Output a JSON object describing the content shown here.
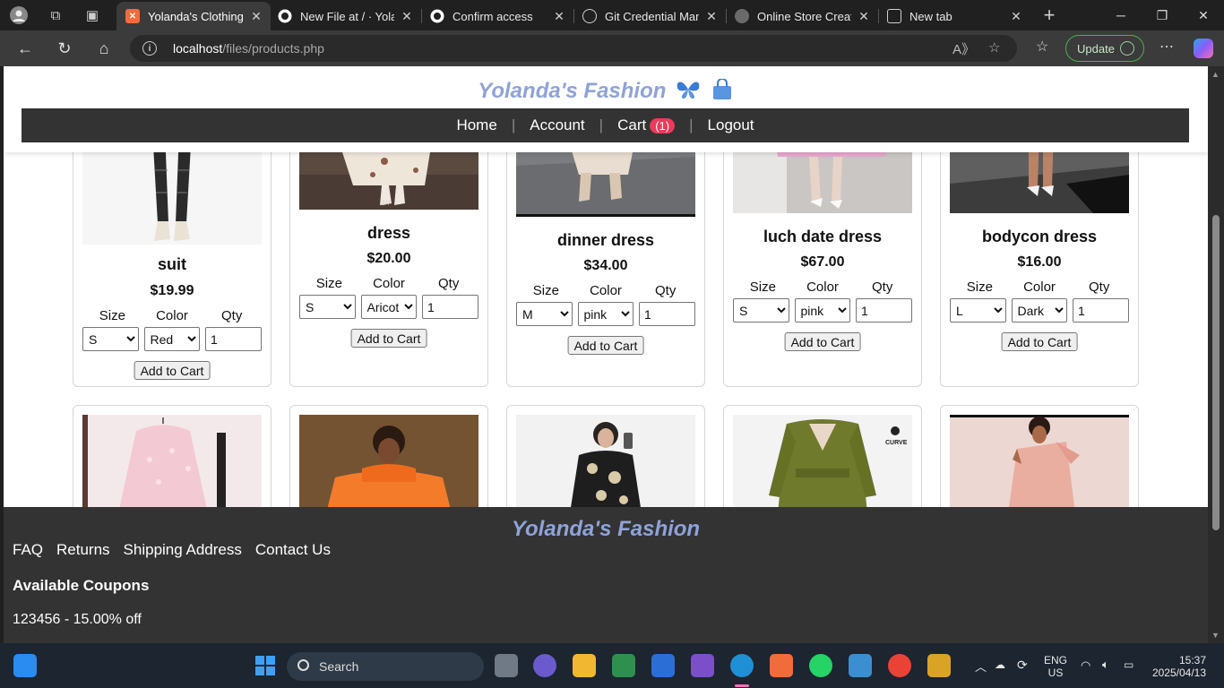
{
  "browser": {
    "tabs": [
      {
        "title": "Yolanda's Clothing",
        "favicon_color": "#f26b3a",
        "active": true
      },
      {
        "title": "New File at / · Yolaga",
        "favicon_color": "#ffffff",
        "active": false
      },
      {
        "title": "Confirm access",
        "favicon_color": "#ffffff",
        "active": false
      },
      {
        "title": "Git Credential Manager",
        "favicon_color": "#cfcfcf",
        "active": false
      },
      {
        "title": "Online Store Creation",
        "favicon_color": "#9e9e9e",
        "active": false
      },
      {
        "title": "New tab",
        "favicon_color": "#cfcfcf",
        "active": false
      }
    ],
    "url_host": "localhost",
    "url_path": "/files/products.php",
    "update_label": "Update"
  },
  "site": {
    "brand": "Yolanda's Fashion",
    "nav": {
      "home": "Home",
      "account": "Account",
      "cart": "Cart",
      "cart_count": "(1)",
      "logout": "Logout"
    }
  },
  "labels": {
    "size": "Size",
    "color": "Color",
    "qty": "Qty",
    "add_to_cart": "Add to Cart"
  },
  "products": [
    {
      "name": "suit",
      "price": "$19.99",
      "size": "S",
      "color": "Red",
      "qty": "1"
    },
    {
      "name": "dress",
      "price": "$20.00",
      "size": "S",
      "color": "Aricot",
      "qty": "1"
    },
    {
      "name": "dinner dress",
      "price": "$34.00",
      "size": "M",
      "color": "pink",
      "qty": "1"
    },
    {
      "name": "luch date dress",
      "price": "$67.00",
      "size": "S",
      "color": "pink",
      "qty": "1"
    },
    {
      "name": "bodycon dress",
      "price": "$16.00",
      "size": "L",
      "color": "Dark",
      "qty": "1"
    }
  ],
  "footer": {
    "brand": "Yolanda's Fashion",
    "links": [
      "FAQ",
      "Returns",
      "Shipping Address",
      "Contact Us"
    ],
    "coupons_title": "Available Coupons",
    "coupon": "123456 - 15.00% off"
  },
  "taskbar": {
    "search": "Search",
    "lang1": "ENG",
    "lang2": "US",
    "time": "15:37",
    "date": "2025/04/13"
  },
  "colors": {
    "accent": "#8fa3d9",
    "badge": "#ec3a5c",
    "navbar": "#333333"
  }
}
